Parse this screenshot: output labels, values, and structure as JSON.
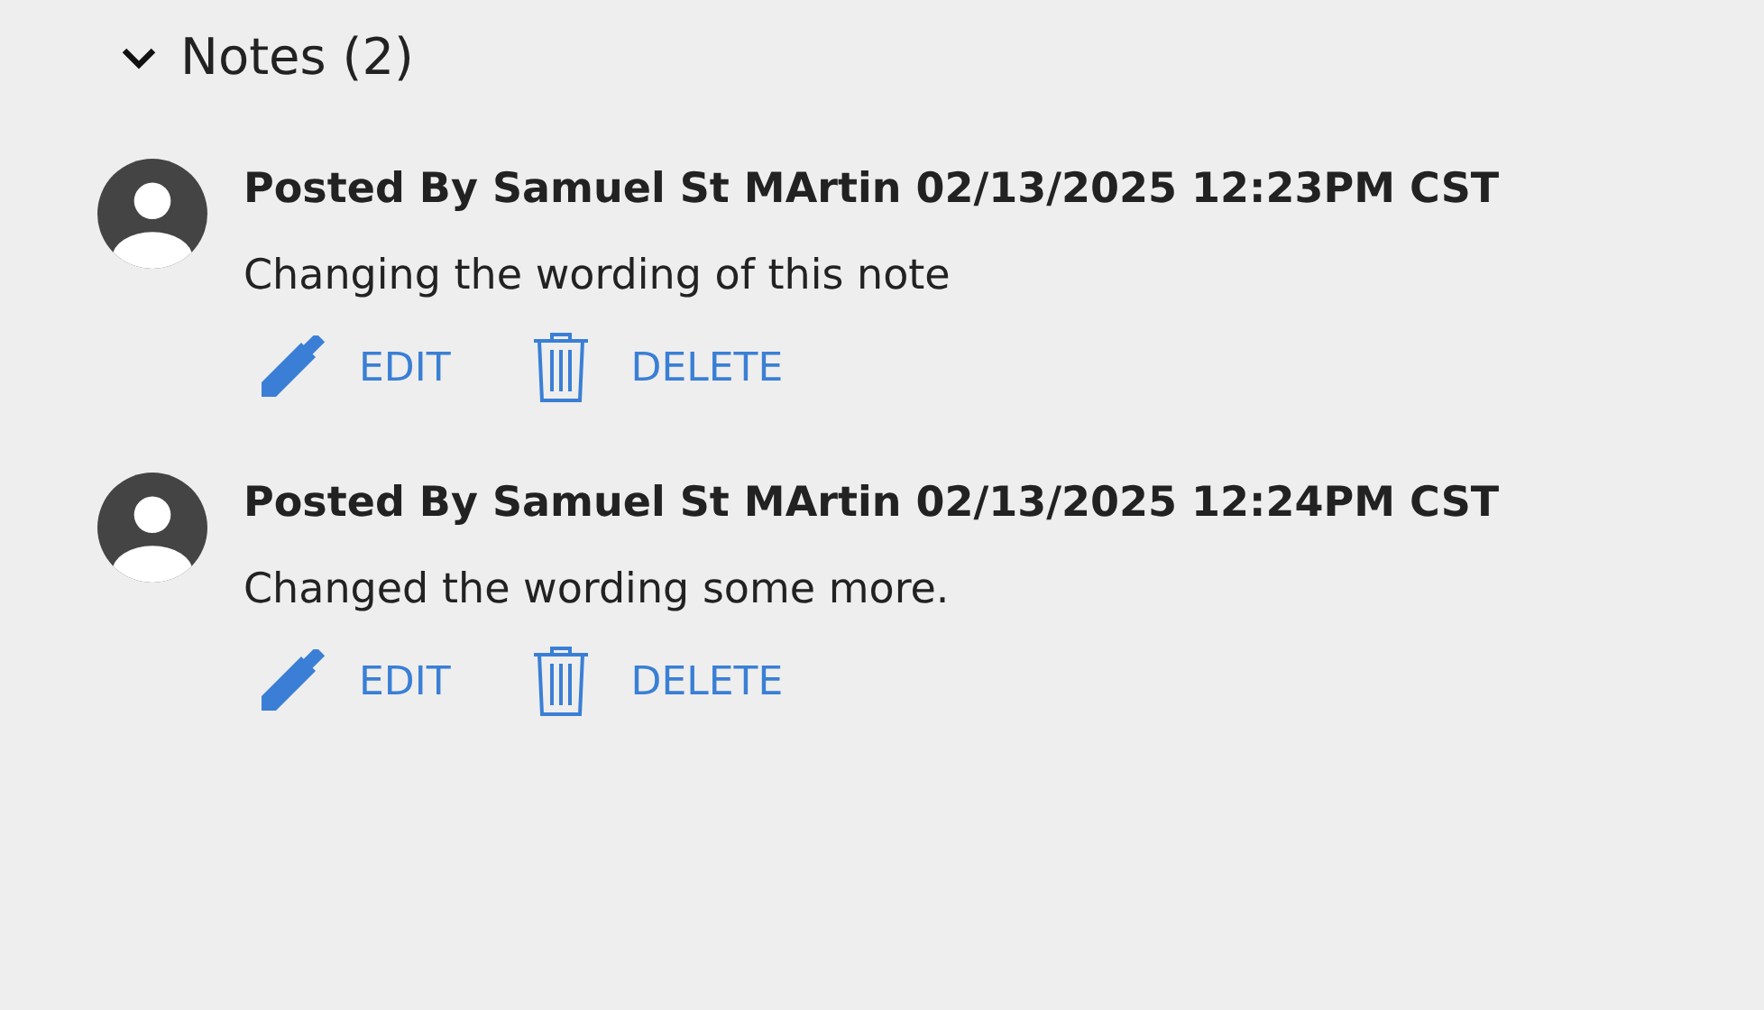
{
  "section": {
    "title": "Notes (2)",
    "expanded": true
  },
  "notes": [
    {
      "posted": "Posted By Samuel St MArtin 02/13/2025 12:23PM CST",
      "text": "Changing the wording of this note",
      "edit": "EDIT",
      "delete": "DELETE"
    },
    {
      "posted": "Posted By Samuel St MArtin 02/13/2025 12:24PM CST",
      "text": "Changed the wording some more.",
      "edit": "EDIT",
      "delete": "DELETE"
    }
  ]
}
